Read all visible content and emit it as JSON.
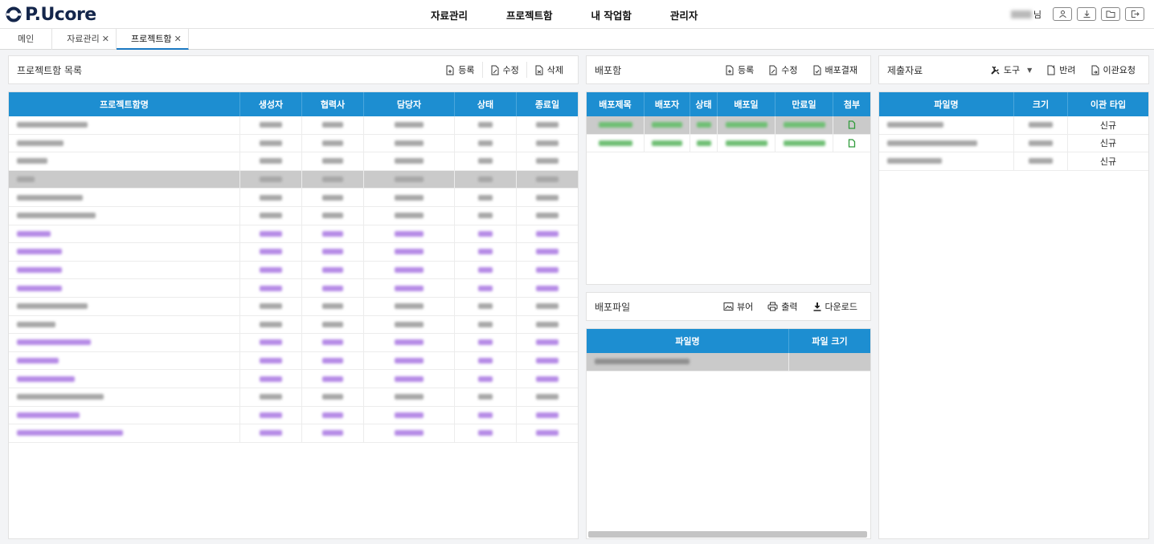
{
  "app": {
    "logo_text": "P.Ucore",
    "user_suffix": "님"
  },
  "nav": [
    "자료관리",
    "프로젝트함",
    "내 작업함",
    "관리자"
  ],
  "tabs": [
    {
      "label": "메인",
      "closable": false
    },
    {
      "label": "자료관리",
      "closable": true
    },
    {
      "label": "프로젝트함",
      "closable": true,
      "active": true
    }
  ],
  "project_panel": {
    "title": "프로젝트함 목록",
    "buttons": {
      "register": "등록",
      "edit": "수정",
      "delete": "삭제"
    },
    "columns": [
      "프로젝트함명",
      "생성자",
      "협력사",
      "담당자",
      "상태",
      "종료일"
    ]
  },
  "deploy_panel": {
    "title": "배포함",
    "buttons": {
      "register": "등록",
      "edit": "수정",
      "approve": "배포결재"
    },
    "columns": [
      "배포제목",
      "배포자",
      "상태",
      "배포일",
      "만료일",
      "첨부"
    ]
  },
  "deploy_file_panel": {
    "title": "배포파일",
    "buttons": {
      "viewer": "뷰어",
      "print": "출력",
      "download": "다운로드"
    },
    "columns": [
      "파일명",
      "파일 크기"
    ]
  },
  "submit_panel": {
    "title": "제출자료",
    "buttons": {
      "tools": "도구",
      "return": "반려",
      "transfer": "이관요청"
    },
    "columns": [
      "파일명",
      "크기",
      "이관 타입"
    ],
    "rows": [
      {
        "type": "신규"
      },
      {
        "type": "신규"
      },
      {
        "type": "신규"
      }
    ]
  },
  "colors": {
    "header_blue": "#1d8ed1",
    "selected_row": "#cacaca",
    "purple_text": "#b58ae6",
    "green_text": "#6fbf74"
  }
}
